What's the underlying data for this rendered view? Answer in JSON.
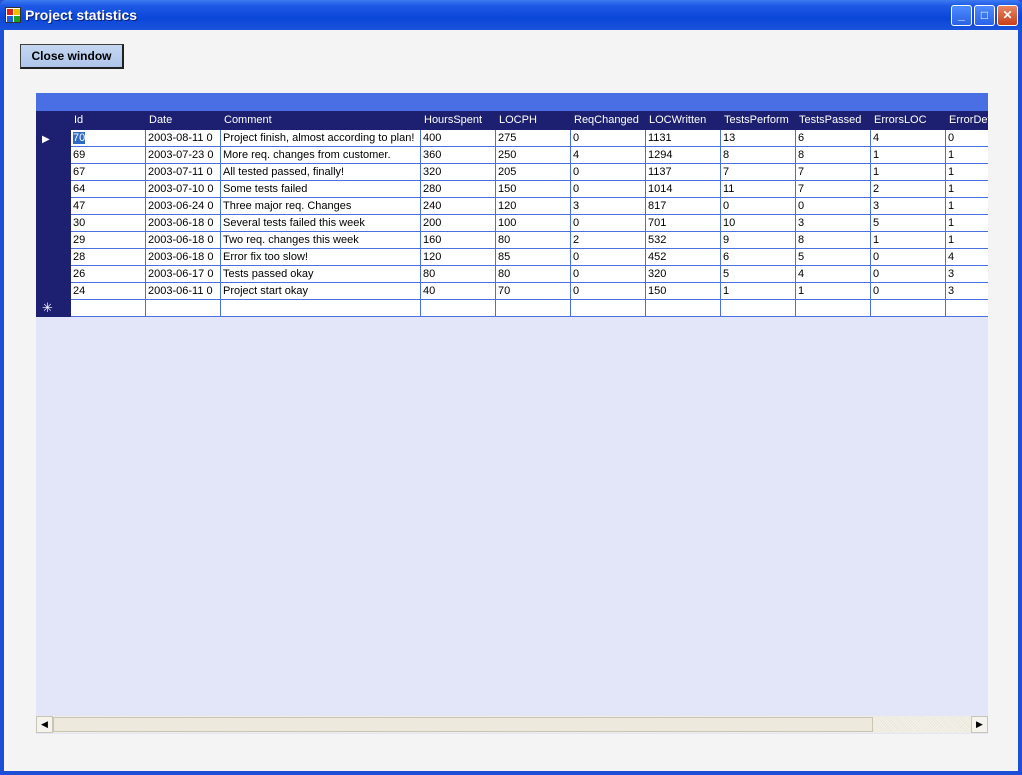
{
  "window": {
    "title": "Project statistics"
  },
  "toolbar": {
    "close_label": "Close window"
  },
  "grid": {
    "columns": [
      "Id",
      "Date",
      "Comment",
      "HoursSpent",
      "LOCPH",
      "ReqChanged",
      "LOCWritten",
      "TestsPerform",
      "TestsPassed",
      "ErrorsLOC",
      "ErrorDef"
    ],
    "rows": [
      [
        "70",
        "2003-08-11 0",
        "Project finish, almost according to plan!",
        "400",
        "275",
        "0",
        "1131",
        "13",
        "6",
        "4",
        "0"
      ],
      [
        "69",
        "2003-07-23 0",
        "More req. changes from customer.",
        "360",
        "250",
        "4",
        "1294",
        "8",
        "8",
        "1",
        "1"
      ],
      [
        "67",
        "2003-07-11 0",
        "All tested passed, finally!",
        "320",
        "205",
        "0",
        "1137",
        "7",
        "7",
        "1",
        "1"
      ],
      [
        "64",
        "2003-07-10 0",
        "Some tests failed",
        "280",
        "150",
        "0",
        "1014",
        "11",
        "7",
        "2",
        "1"
      ],
      [
        "47",
        "2003-06-24 0",
        "Three major req. Changes",
        "240",
        "120",
        "3",
        "817",
        "0",
        "0",
        "3",
        "1"
      ],
      [
        "30",
        "2003-06-18 0",
        "Several tests failed this week",
        "200",
        "100",
        "0",
        "701",
        "10",
        "3",
        "5",
        "1"
      ],
      [
        "29",
        "2003-06-18 0",
        "Two req. changes this week",
        "160",
        "80",
        "2",
        "532",
        "9",
        "8",
        "1",
        "1"
      ],
      [
        "28",
        "2003-06-18 0",
        "Error fix too slow!",
        "120",
        "85",
        "0",
        "452",
        "6",
        "5",
        "0",
        "4"
      ],
      [
        "26",
        "2003-06-17 0",
        "Tests passed okay",
        "80",
        "80",
        "0",
        "320",
        "5",
        "4",
        "0",
        "3"
      ],
      [
        "24",
        "2003-06-11 0",
        "Project start okay",
        "40",
        "70",
        "0",
        "150",
        "1",
        "1",
        "0",
        "3"
      ]
    ],
    "current_row_marker": "▶",
    "new_row_marker": "✳"
  },
  "icons": {
    "minimize": "minimize-icon",
    "maximize": "maximize-icon",
    "close": "close-icon",
    "scroll_left": "arrow-left-icon",
    "scroll_right": "arrow-right-icon"
  }
}
